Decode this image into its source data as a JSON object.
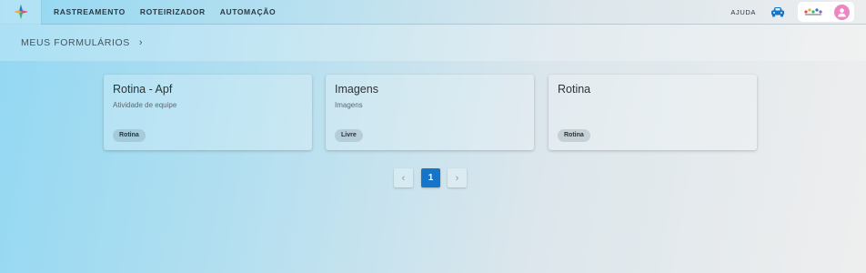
{
  "nav": {
    "items": [
      "RASTREAMENTO",
      "ROTEIRIZADOR",
      "AUTOMAÇÃO"
    ],
    "help_label": "AJUDA"
  },
  "icons": {
    "logo": "app-logo-icon",
    "vehicle": "car-icon",
    "company": "company-logo-icon",
    "user": "user-avatar-icon"
  },
  "colors": {
    "accent": "#1675c9",
    "avatar": "#ee85c2"
  },
  "breadcrumb": {
    "title": "MEUS FORMULÁRIOS",
    "chevron": "›"
  },
  "cards": [
    {
      "title": "Rotina - Apf",
      "subtitle": "Atividade de equipe",
      "badge": "Rotina"
    },
    {
      "title": "Imagens",
      "subtitle": "Imagens",
      "badge": "Livre"
    },
    {
      "title": "Rotina",
      "subtitle": "",
      "badge": "Rotina"
    }
  ],
  "pagination": {
    "prev": "‹",
    "current": "1",
    "next": "›"
  }
}
